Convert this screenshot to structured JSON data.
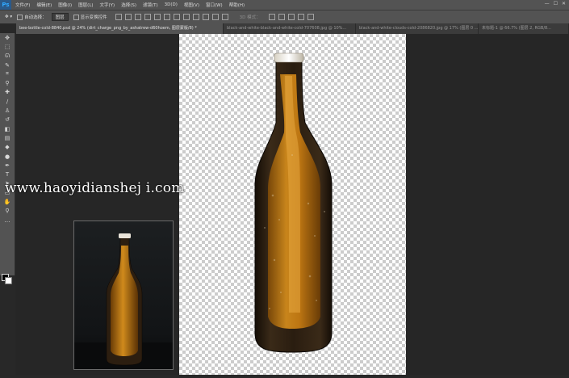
{
  "menubar": {
    "logo": "Ps",
    "items": [
      "文件(F)",
      "编辑(E)",
      "图像(I)",
      "图层(L)",
      "文字(Y)",
      "选择(S)",
      "滤镜(T)",
      "3D(D)",
      "视图(V)",
      "窗口(W)",
      "帮助(H)"
    ],
    "window_controls": [
      "—",
      "☐",
      "✕"
    ]
  },
  "options": {
    "auto_select_label": "自动选择：",
    "auto_select_value": "图层",
    "show_transform_label": "显示变换控件",
    "mode3d_label": "3D 模式："
  },
  "tabs": [
    {
      "label": "bee-bottle-cold-8840.psd @ 24% (dirt_charge_png_by_ashatrew-d60hoem, 图层蒙版/8) *",
      "active": true
    },
    {
      "label": "black-and-white-black-and-white-cold-707608.jpg @ 10%...",
      "active": false
    },
    {
      "label": "black-and-white-clouds-cold-2086820.jpg @ 17% (图层 0 ...",
      "active": false
    },
    {
      "label": "未标题-1 @ 66.7% (图层 2, RGB/8...",
      "active": false
    }
  ],
  "toolbox": {
    "tools": [
      "move-tool",
      "marquee-tool",
      "lasso-tool",
      "quick-select-tool",
      "crop-tool",
      "eyedropper-tool",
      "healing-brush-tool",
      "brush-tool",
      "clone-stamp-tool",
      "history-brush-tool",
      "eraser-tool",
      "gradient-tool",
      "blur-tool",
      "dodge-tool",
      "pen-tool",
      "type-tool",
      "path-select-tool",
      "shape-tool",
      "hand-tool",
      "zoom-tool",
      "more-tools"
    ],
    "glyphs": [
      "✥",
      "⬚",
      "ᘏ",
      "✎",
      "⌗",
      "⚲",
      "✚",
      "∕",
      "♙",
      "↺",
      "◧",
      "▤",
      "◆",
      "●",
      "✒",
      "T",
      "➤",
      "▭",
      "✋",
      "⚲",
      "…"
    ],
    "foreground_color": "#000000",
    "background_color": "#ffffff"
  },
  "watermark": "www.haoyidianshej i.com"
}
